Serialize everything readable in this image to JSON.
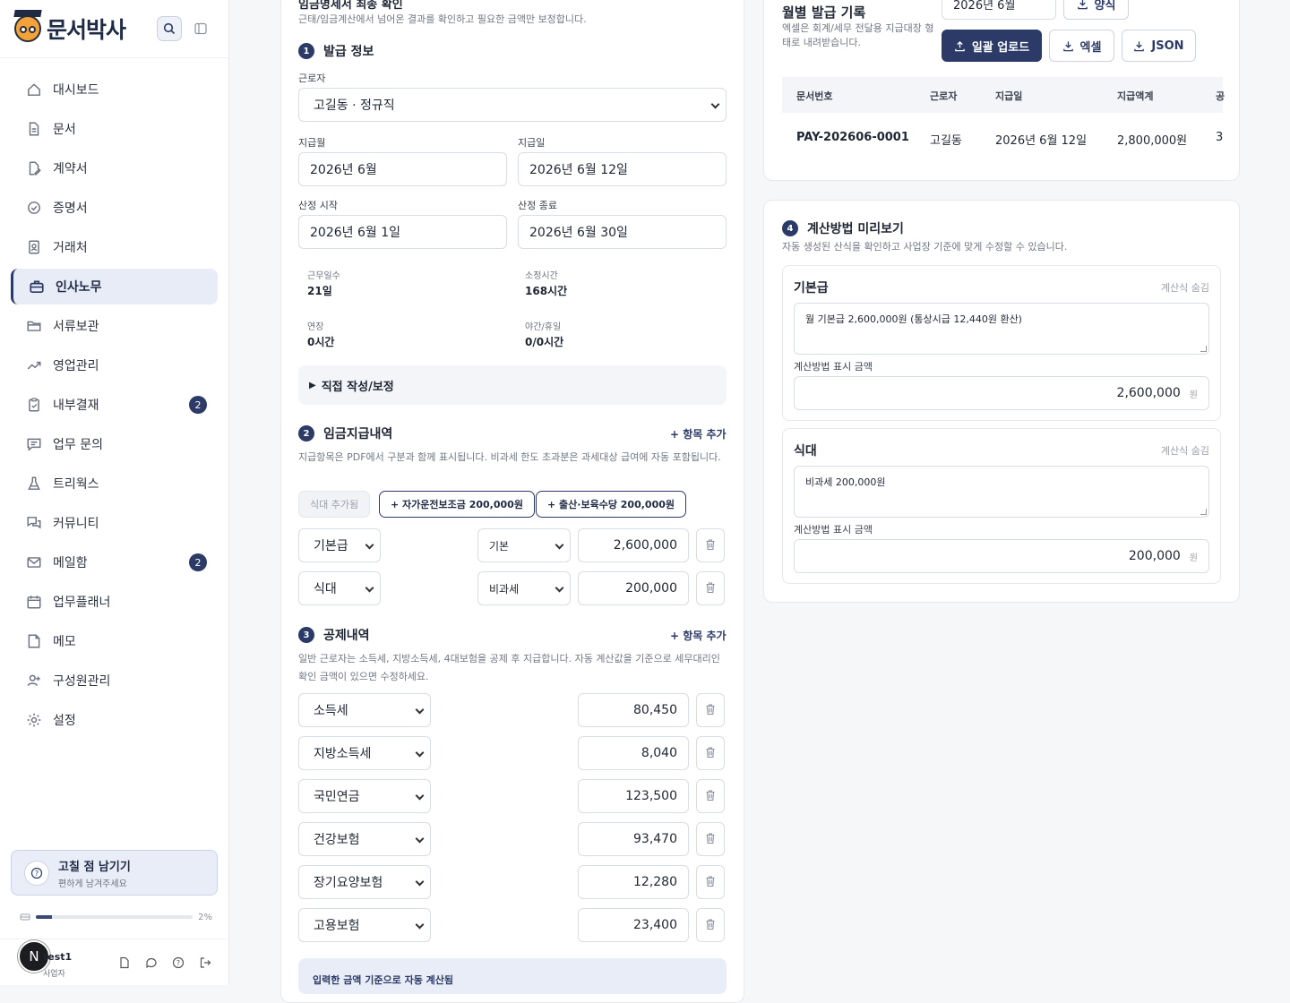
{
  "brand": {
    "name": "문서박사"
  },
  "sidebar": {
    "items": [
      {
        "label": "대시보드",
        "icon": "home-icon"
      },
      {
        "label": "문서",
        "icon": "document-icon"
      },
      {
        "label": "계약서",
        "icon": "contract-icon"
      },
      {
        "label": "증명서",
        "icon": "certificate-icon"
      },
      {
        "label": "거래처",
        "icon": "client-icon"
      },
      {
        "label": "인사노무",
        "icon": "briefcase-icon",
        "active": true
      },
      {
        "label": "서류보관",
        "icon": "folder-icon"
      },
      {
        "label": "영업관리",
        "icon": "trend-icon"
      },
      {
        "label": "내부결재",
        "icon": "clipboard-icon",
        "badge": "2"
      },
      {
        "label": "업무 문의",
        "icon": "message-icon"
      },
      {
        "label": "트리웍스",
        "icon": "flask-icon"
      },
      {
        "label": "커뮤니티",
        "icon": "chat-icon"
      },
      {
        "label": "메일함",
        "icon": "mail-icon",
        "badge": "2"
      },
      {
        "label": "업무플래너",
        "icon": "calendar-icon"
      },
      {
        "label": "메모",
        "icon": "memo-icon"
      },
      {
        "label": "구성원관리",
        "icon": "user-add-icon"
      },
      {
        "label": "설정",
        "icon": "gear-icon"
      }
    ],
    "feedback_title": "고칠 점 남기기",
    "feedback_sub": "편하게 남겨주세요",
    "storage_pct": "2%",
    "storage_fraction": 0.02,
    "user_initial": "N",
    "user_name": "test1",
    "user_role": "사업자"
  },
  "form": {
    "top_desc": "근태/임금계산에서 넘어온 결과를 확인하고 필요한 금액만 보정합니다.",
    "sec1_num": "1",
    "sec1_title": "발급 정보",
    "worker_label": "근로자",
    "worker_value": "고길동 · 정규직",
    "pay_month_label": "지급월",
    "pay_month_value": "2026년 6월",
    "pay_date_label": "지급일",
    "pay_date_value": "2026년 6월 12일",
    "start_label": "산정 시작",
    "start_value": "2026년 6월 1일",
    "end_label": "산정 종료",
    "end_value": "2026년 6월 30일",
    "stats": {
      "workdays_label": "근무일수",
      "workdays": "21일",
      "hours_label": "소정시간",
      "hours": "168시간",
      "overtime_label": "연장",
      "overtime": "0시간",
      "night_label": "야간/휴일",
      "night": "0/0시간"
    },
    "manual_label": "직접 작성/보정",
    "sec2_num": "2",
    "sec2_title": "임금지급내역",
    "sec2_add": "+ 항목 추가",
    "sec2_desc": "지급항목은 PDF에서 구분과 함께 표시됩니다. 비과세 한도 초과분은 과세대상 급여에 자동 포함됩니다.",
    "chips": [
      "식대 추가됨",
      "+ 자가운전보조금 200,000원",
      "+ 출산·보육수당 200,000원"
    ],
    "pay_items": [
      {
        "name": "기본급",
        "type": "기본",
        "amount": "2,600,000"
      },
      {
        "name": "식대",
        "type": "비과세",
        "amount": "200,000"
      }
    ],
    "sec3_num": "3",
    "sec3_title": "공제내역",
    "sec3_add": "+ 항목 추가",
    "sec3_desc": "일반 근로자는 소득세, 지방소득세, 4대보험을 공제 후 지급합니다. 자동 계산값을 기준으로 세무대리인 확인 금액이 있으면 수정하세요.",
    "deductions": [
      {
        "name": "소득세",
        "amount": "80,450"
      },
      {
        "name": "지방소득세",
        "amount": "8,040"
      },
      {
        "name": "국민연금",
        "amount": "123,500"
      },
      {
        "name": "건강보험",
        "amount": "93,470"
      },
      {
        "name": "장기요양보험",
        "amount": "12,280"
      },
      {
        "name": "고용보험",
        "amount": "23,400"
      }
    ],
    "auto_note": "입력한 금액 기준으로 자동 계산됨"
  },
  "records": {
    "title": "월별 발급 기록",
    "desc": "엑셀은 회계/세무 전달용 지급대장 형태로 내려받습니다.",
    "month_value": "2026년 6월",
    "template_btn": "양식",
    "upload_btn": "일괄 업로드",
    "excel_btn": "엑셀",
    "json_btn": "JSON",
    "columns": [
      "문서번호",
      "근로자",
      "지급일",
      "지급액계",
      "공"
    ],
    "rows": [
      [
        "PAY-202606-0001",
        "고길동",
        "2026년 6월 12일",
        "2,800,000원",
        "3"
      ]
    ]
  },
  "preview": {
    "num": "4",
    "title": "계산방법 미리보기",
    "desc": "자동 생성된 산식을 확인하고 사업장 기준에 맞게 수정할 수 있습니다.",
    "hide_label": "계산식 숨김",
    "amount_label": "계산방법 표시 금액",
    "unit": "원",
    "cards": [
      {
        "title": "기본급",
        "formula": "월 기본급 2,600,000원 (통상시급 12,440원 환산)",
        "amount": "2,600,000"
      },
      {
        "title": "식대",
        "formula": "비과세 200,000원",
        "amount": "200,000"
      }
    ]
  }
}
